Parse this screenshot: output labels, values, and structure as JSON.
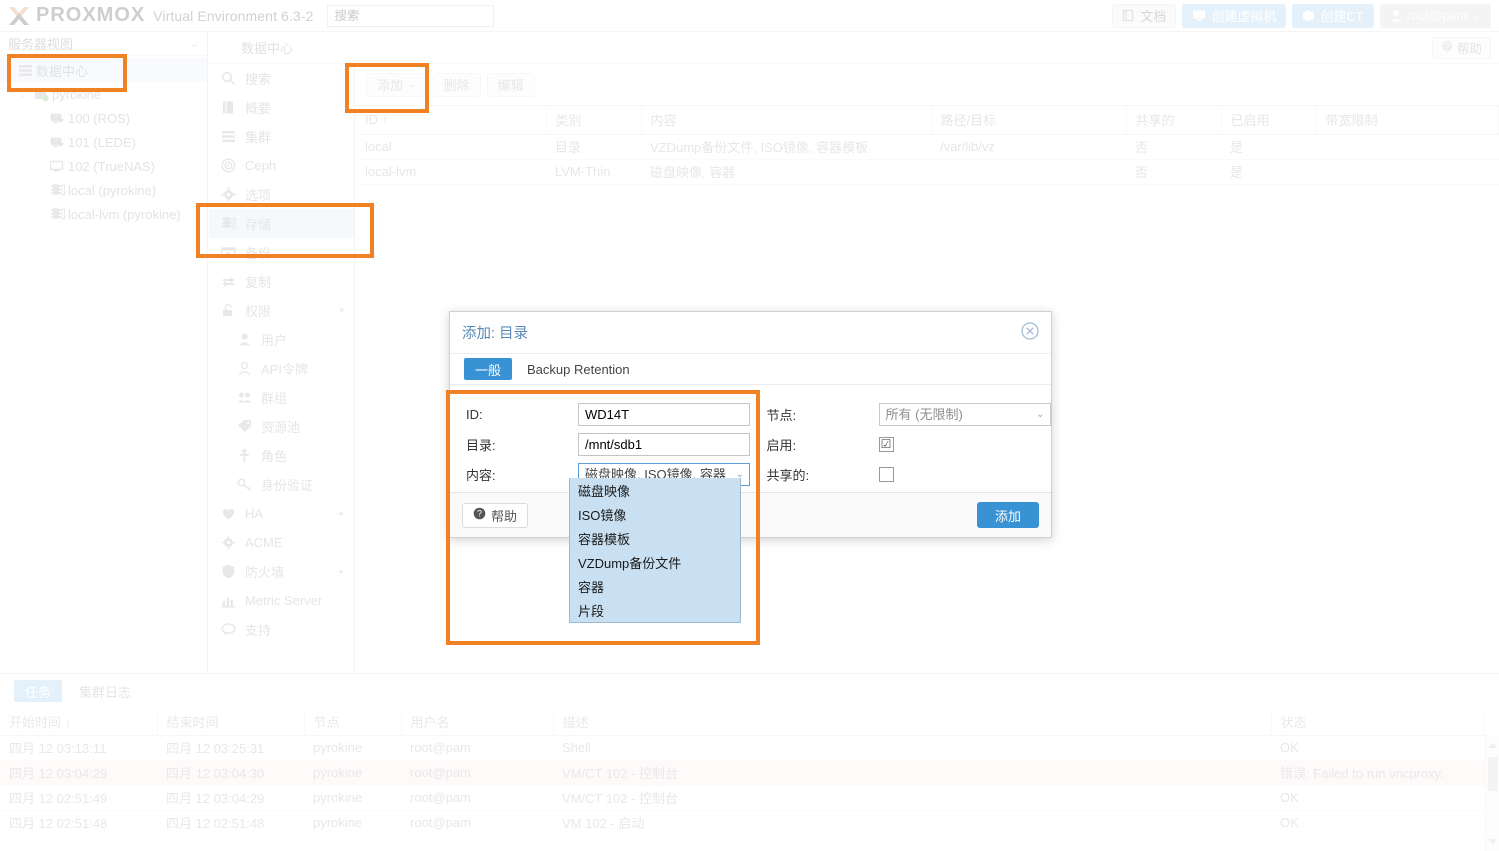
{
  "header": {
    "product_name": "PROXMOX",
    "product_subtitle": "Virtual Environment 6.3-2",
    "search_placeholder": "搜索",
    "buttons": [
      {
        "label": "文档",
        "icon": "book-icon",
        "style": "plain"
      },
      {
        "label": "创建虚拟机",
        "icon": "monitor-icon",
        "style": "blue"
      },
      {
        "label": "创建CT",
        "icon": "cube-icon",
        "style": "blue"
      },
      {
        "label": "root@pam",
        "icon": "user-icon",
        "style": "grey",
        "caret": "⌄"
      }
    ]
  },
  "sidebar": {
    "view_selector": "服务器视图",
    "tree": [
      {
        "label": "数据中心",
        "icon": "datacenter-icon",
        "depth": 0,
        "selected": true,
        "expander": "⌄"
      },
      {
        "label": "pyrokine",
        "icon": "node-icon",
        "depth": 1,
        "selected": false,
        "expander": "⌄"
      },
      {
        "label": "100 (ROS)",
        "icon": "vm-running-icon",
        "depth": 2,
        "selected": false,
        "expander": ""
      },
      {
        "label": "101 (LEDE)",
        "icon": "vm-running-icon",
        "depth": 2,
        "selected": false,
        "expander": ""
      },
      {
        "label": "102 (TrueNAS)",
        "icon": "vm-stopped-icon",
        "depth": 2,
        "selected": false,
        "expander": ""
      },
      {
        "label": "local (pyrokine)",
        "icon": "storage-icon",
        "depth": 2,
        "selected": false,
        "expander": ""
      },
      {
        "label": "local-lvm (pyrokine)",
        "icon": "storage-icon",
        "depth": 2,
        "selected": false,
        "expander": ""
      }
    ]
  },
  "nav": {
    "items": [
      {
        "label": "搜索",
        "icon": "search-icon",
        "sub": false,
        "active": false,
        "arrow": ""
      },
      {
        "label": "概要",
        "icon": "book-icon",
        "sub": false,
        "active": false,
        "arrow": ""
      },
      {
        "label": "集群",
        "icon": "cluster-icon",
        "sub": false,
        "active": false,
        "arrow": ""
      },
      {
        "label": "Ceph",
        "icon": "ceph-icon",
        "sub": false,
        "active": false,
        "arrow": ""
      },
      {
        "label": "选项",
        "icon": "gear-icon",
        "sub": false,
        "active": false,
        "arrow": ""
      },
      {
        "label": "存储",
        "icon": "storage-icon",
        "sub": false,
        "active": true,
        "arrow": ""
      },
      {
        "label": "备份",
        "icon": "backup-icon",
        "sub": false,
        "active": false,
        "arrow": ""
      },
      {
        "label": "复制",
        "icon": "replicate-icon",
        "sub": false,
        "active": false,
        "arrow": ""
      },
      {
        "label": "权限",
        "icon": "lock-icon",
        "sub": false,
        "active": false,
        "arrow": "▾"
      },
      {
        "label": "用户",
        "icon": "user-icon",
        "sub": true,
        "active": false,
        "arrow": ""
      },
      {
        "label": "API令牌",
        "icon": "token-icon",
        "sub": true,
        "active": false,
        "arrow": ""
      },
      {
        "label": "群组",
        "icon": "group-icon",
        "sub": true,
        "active": false,
        "arrow": ""
      },
      {
        "label": "资源池",
        "icon": "tag-icon",
        "sub": true,
        "active": false,
        "arrow": ""
      },
      {
        "label": "角色",
        "icon": "role-icon",
        "sub": true,
        "active": false,
        "arrow": ""
      },
      {
        "label": "身份验证",
        "icon": "key-icon",
        "sub": true,
        "active": false,
        "arrow": ""
      },
      {
        "label": "HA",
        "icon": "ha-icon",
        "sub": false,
        "active": false,
        "arrow": "▸"
      },
      {
        "label": "ACME",
        "icon": "acme-icon",
        "sub": false,
        "active": false,
        "arrow": ""
      },
      {
        "label": "防火墙",
        "icon": "shield-icon",
        "sub": false,
        "active": false,
        "arrow": "▸"
      },
      {
        "label": "Metric Server",
        "icon": "chart-icon",
        "sub": false,
        "active": false,
        "arrow": ""
      },
      {
        "label": "支持",
        "icon": "support-icon",
        "sub": false,
        "active": false,
        "arrow": ""
      }
    ]
  },
  "breadcrumb": {
    "text": "数据中心",
    "help_label": "帮助"
  },
  "main": {
    "toolbar": [
      {
        "label": "添加",
        "caret": "⌄"
      },
      {
        "label": "删除",
        "caret": ""
      },
      {
        "label": "编辑",
        "caret": ""
      }
    ],
    "columns": [
      "ID ↑",
      "类别",
      "内容",
      "路径/目标",
      "共享的",
      "已启用",
      "带宽限制"
    ],
    "rows": [
      {
        "id": "local",
        "type": "目录",
        "content": "VZDump备份文件, ISO镜像, 容器模板",
        "path": "/var/lib/vz",
        "shared": "否",
        "enabled": "是",
        "bwlimit": ""
      },
      {
        "id": "local-lvm",
        "type": "LVM-Thin",
        "content": "磁盘映像, 容器",
        "path": "",
        "shared": "否",
        "enabled": "是",
        "bwlimit": ""
      }
    ]
  },
  "dialog": {
    "title": "添加: 目录",
    "close_icon": "close-icon",
    "tabs": [
      {
        "label": "一般",
        "active": true
      },
      {
        "label": "Backup Retention",
        "active": false
      }
    ],
    "fields": {
      "id_label": "ID:",
      "id_value": "WD14T",
      "dir_label": "目录:",
      "dir_value": "/mnt/sdb1",
      "content_label": "内容:",
      "content_value": "磁盘映像, ISO镜像, 容器",
      "node_label": "节点:",
      "node_value": "所有 (无限制)",
      "enable_label": "启用:",
      "enable_checked": "☑",
      "shared_label": "共享的:",
      "shared_checked": ""
    },
    "content_options": [
      "磁盘映像",
      "ISO镜像",
      "容器模板",
      "VZDump备份文件",
      "容器",
      "片段"
    ],
    "help_label": "帮助",
    "submit_label": "添加"
  },
  "tasks": {
    "tabs": [
      {
        "label": "任务",
        "active": true
      },
      {
        "label": "集群日志",
        "active": false
      }
    ],
    "columns": [
      "开始时间 ↓",
      "结束时间",
      "节点",
      "用户名",
      "描述",
      "状态"
    ],
    "rows": [
      {
        "start": "四月 12 03:13:11",
        "end": "四月 12 03:25:31",
        "node": "pyrokine",
        "user": "root@pam",
        "desc": "Shell",
        "status": "OK",
        "error": false
      },
      {
        "start": "四月 12 03:04:29",
        "end": "四月 12 03:04:30",
        "node": "pyrokine",
        "user": "root@pam",
        "desc": "VM/CT 102 - 控制台",
        "status": "错误: Failed to run vncproxy.",
        "error": true
      },
      {
        "start": "四月 12 02:51:49",
        "end": "四月 12 03:04:29",
        "node": "pyrokine",
        "user": "root@pam",
        "desc": "VM/CT 102 - 控制台",
        "status": "OK",
        "error": false
      },
      {
        "start": "四月 12 02:51:48",
        "end": "四月 12 02:51:48",
        "node": "pyrokine",
        "user": "root@pam",
        "desc": "VM 102 - 启动",
        "status": "OK",
        "error": false
      }
    ]
  },
  "annotations": {
    "color": "#f08124",
    "boxes": [
      "datacenter-tree-item",
      "add-storage-button",
      "storage-nav-item",
      "dialog-form-area"
    ]
  }
}
